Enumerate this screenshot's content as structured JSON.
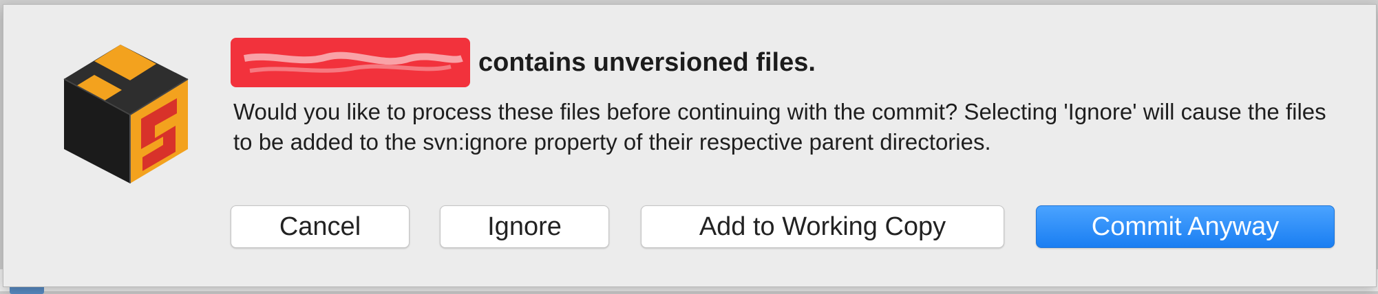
{
  "dialog": {
    "title_suffix": "contains unversioned files.",
    "message": "Would you like to process these files before continuing with the commit? Selecting 'Ignore' will cause the files to be added to the svn:ignore property of their respective parent directories.",
    "icon": "versions-app-icon",
    "redaction_color": "#f2323c"
  },
  "buttons": {
    "cancel": "Cancel",
    "ignore": "Ignore",
    "add": "Add to Working Copy",
    "commit": "Commit Anyway"
  },
  "colors": {
    "primary_button": "#1a7ef2",
    "dialog_background": "#ececec"
  }
}
